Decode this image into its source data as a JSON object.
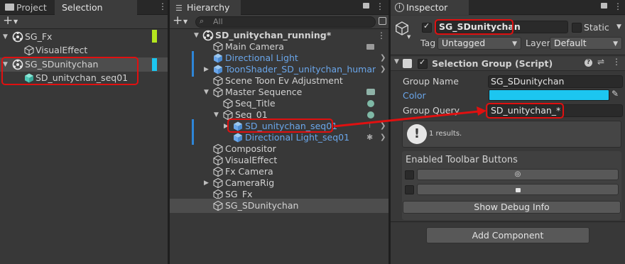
{
  "colors": {
    "accent_blue": "#2e86d8",
    "link_blue": "#6aa6ea",
    "highlight_red": "#e01010",
    "group_fx_color": "#b4e61e",
    "group_sd_color": "#1cc6f0",
    "color_field": "#1cc6f0",
    "selection_row": "#4d4d4d"
  },
  "selection_groups": {
    "tabs": [
      {
        "label": "Project"
      },
      {
        "label": "Selection Groups"
      }
    ],
    "toolbar_add": "+",
    "items": [
      {
        "label": "SG_Fx",
        "icon": "unity-prefab-icon",
        "expanded": true
      },
      {
        "label": "VisualEffect",
        "icon": "gameobject-outline-icon"
      },
      {
        "label": "SG_SDunitychan",
        "icon": "unity-prefab-icon",
        "expanded": true,
        "selected": true
      },
      {
        "label": "SD_unitychan_seq01",
        "icon": "prefab-cube-icon"
      }
    ]
  },
  "hierarchy": {
    "tab": "Hierarchy",
    "toolbar_add": "+",
    "search_placeholder": "All",
    "scene": "SD_unitychan_running*",
    "items": [
      {
        "label": "Main Camera",
        "icon": "gameobject-icon"
      },
      {
        "label": "Directional Light",
        "icon": "prefab-cube-icon"
      },
      {
        "label": "ToonShader_SD_unitychan_humanoid",
        "icon": "prefab-cube-icon"
      },
      {
        "label": "Scene Toon Ev Adjustment",
        "icon": "gameobject-icon"
      },
      {
        "label": "Master Sequence",
        "icon": "gameobject-icon"
      },
      {
        "label": "Seq_Title",
        "icon": "gameobject-icon"
      },
      {
        "label": "Seq_01",
        "icon": "gameobject-icon"
      },
      {
        "label": "SD_unitychan_seq01",
        "icon": "prefab-cube-icon"
      },
      {
        "label": "Directional Light_seq01",
        "icon": "prefab-cube-icon"
      },
      {
        "label": "Compositor",
        "icon": "gameobject-icon"
      },
      {
        "label": "VisualEffect",
        "icon": "gameobject-icon"
      },
      {
        "label": "Fx Camera",
        "icon": "gameobject-icon"
      },
      {
        "label": "CameraRig",
        "icon": "gameobject-icon"
      },
      {
        "label": "SG_Fx",
        "icon": "gameobject-icon"
      },
      {
        "label": "SG_SDunitychan",
        "icon": "gameobject-icon"
      }
    ]
  },
  "inspector": {
    "tab": "Inspector",
    "object_name": "SG_SDunitychan",
    "static_label": "Static",
    "tag_label": "Tag",
    "tag_value": "Untagged",
    "layer_label": "Layer",
    "layer_value": "Default",
    "component_title": "Selection Group (Script)",
    "group_name_label": "Group Name",
    "group_name_value": "SG_SDunitychan",
    "color_label": "Color",
    "group_query_label": "Group Query",
    "group_query_value": "SD_unitychan_*",
    "results_text": "1 results.",
    "enabled_toolbar_label": "Enabled Toolbar Buttons",
    "show_debug_button": "Show Debug Info",
    "add_component_button": "Add Component"
  }
}
